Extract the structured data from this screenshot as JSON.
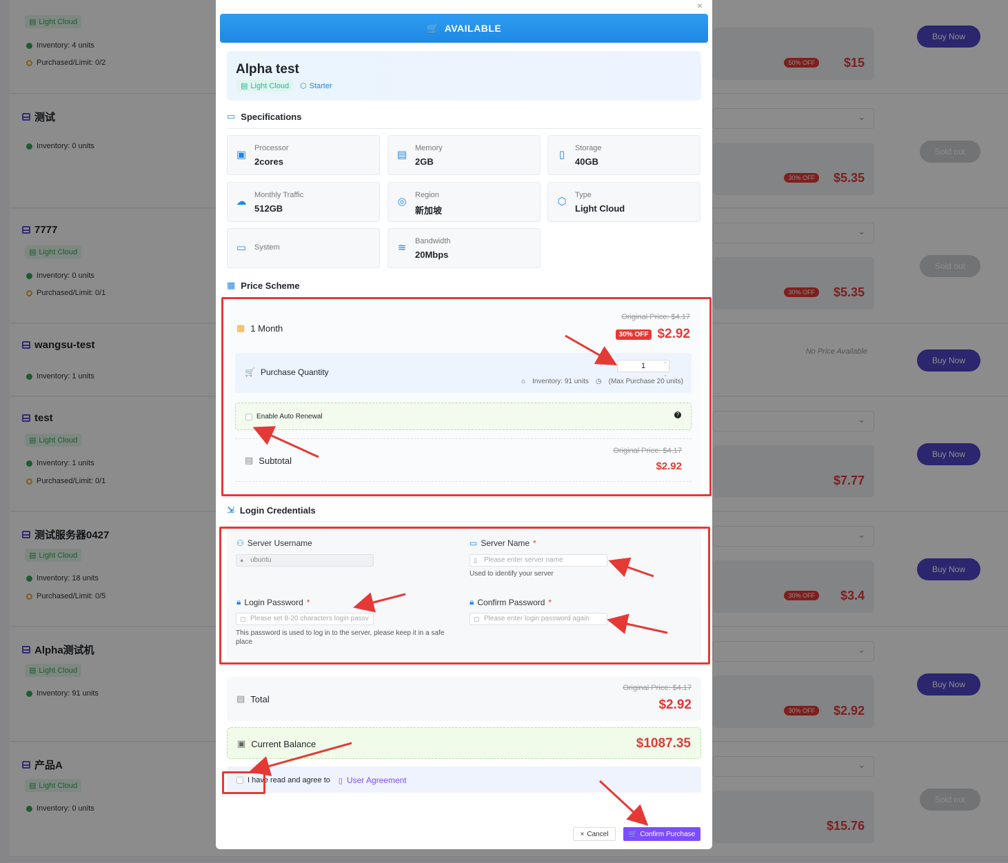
{
  "background": {
    "products": [
      {
        "name": "",
        "tag": "Light Cloud",
        "inventory": "Inventory: 4 units",
        "limit": "Purchased/Limit: 0/2",
        "off": "50% OFF",
        "price": "$15",
        "action": "Buy Now"
      },
      {
        "name": "测试",
        "tag": "",
        "inventory": "Inventory: 0 units",
        "limit": "",
        "off": "30% OFF",
        "price": "$5.35",
        "action": "Sold out"
      },
      {
        "name": "7777",
        "tag": "Light Cloud",
        "inventory": "Inventory: 0 units",
        "limit": "Purchased/Limit: 0/1",
        "off": "30% OFF",
        "price": "$5.35",
        "action": "Sold out"
      },
      {
        "name": "wangsu-test",
        "tag": "",
        "inventory": "Inventory: 1 units",
        "limit": "",
        "no_price": "No Price Available",
        "action": "Buy Now"
      },
      {
        "name": "test",
        "tag": "Light Cloud",
        "inventory": "Inventory: 1 units",
        "limit": "Purchased/Limit: 0/1",
        "price": "$7.77",
        "action": "Buy Now"
      },
      {
        "name": "测试服务器0427",
        "tag": "Light Cloud",
        "inventory": "Inventory: 18 units",
        "limit": "Purchased/Limit: 0/5",
        "off": "30% OFF",
        "price": "$3.4",
        "action": "Buy Now"
      },
      {
        "name": "Alpha测试机",
        "tag": "Light Cloud",
        "inventory": "Inventory: 91 units",
        "limit": "",
        "off": "30% OFF",
        "price": "$2.92",
        "action": "Buy Now"
      },
      {
        "name": "产品A",
        "tag": "Light Cloud",
        "inventory": "Inventory: 0 units",
        "limit": "",
        "price": "$15.76",
        "action": "Sold out"
      }
    ]
  },
  "modal": {
    "status": "AVAILABLE",
    "title": "Alpha test",
    "chip_type": "Light Cloud",
    "chip_plan": "Starter",
    "specs_title": "Specifications",
    "specs": [
      {
        "label": "Processor",
        "value": "2cores",
        "icon": "cpu-icon"
      },
      {
        "label": "Memory",
        "value": "2GB",
        "icon": "memory-icon"
      },
      {
        "label": "Storage",
        "value": "40GB",
        "icon": "storage-icon"
      },
      {
        "label": "Monthly Traffic",
        "value": "512GB",
        "icon": "cloud-download-icon"
      },
      {
        "label": "Region",
        "value": "新加坡",
        "icon": "location-icon"
      },
      {
        "label": "Type",
        "value": "Light Cloud",
        "icon": "cube-icon"
      },
      {
        "label": "System",
        "value": "",
        "icon": "monitor-icon"
      },
      {
        "label": "Bandwidth",
        "value": "20Mbps",
        "icon": "wifi-icon"
      }
    ],
    "price_title": "Price Scheme",
    "plan": {
      "period": "1 Month",
      "original": "Original Price: $4.17",
      "off": "30% OFF",
      "price": "$2.92"
    },
    "quantity": {
      "label": "Purchase Quantity",
      "value": "1",
      "inventory": "Inventory: 91 units",
      "max": "(Max Purchase 20 units)"
    },
    "auto_renew": "Enable Auto Renewal",
    "subtotal": {
      "label": "Subtotal",
      "original": "Original Price: $4.17",
      "price": "$2.92"
    },
    "cred_title": "Login Credentials",
    "username": {
      "label": "Server Username",
      "value": "ubuntu"
    },
    "server_name": {
      "label": "Server Name",
      "placeholder": "Please enter server name",
      "hint": "Used to identify your server"
    },
    "password": {
      "label": "Login Password",
      "placeholder": "Please set 8-20 characters login passv",
      "hint": "This password is used to log in to the server, please keep it in a safe place"
    },
    "confirm_password": {
      "label": "Confirm Password",
      "placeholder": "Please enter login password again"
    },
    "required_mark": "*",
    "total": {
      "label": "Total",
      "original": "Original Price: $4.17",
      "price": "$2.92"
    },
    "balance": {
      "label": "Current Balance",
      "value": "$1087.35"
    },
    "agree": {
      "text": "I have read and agree to",
      "link": "User Agreement"
    },
    "cancel": "Cancel",
    "confirm": "Confirm Purchase",
    "close": "×"
  },
  "colors": {
    "accent": "#1e88e5",
    "danger": "#e53935",
    "purple": "#7c4dff",
    "annotation": "#e53935"
  }
}
